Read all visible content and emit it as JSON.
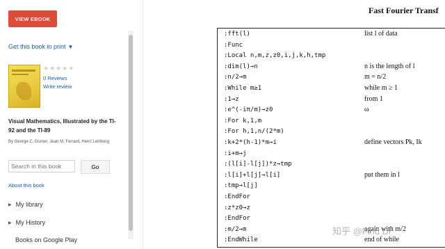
{
  "sidebar": {
    "view_ebook": "VIEW EBOOK",
    "get_print": "Get this book in print",
    "reviews_count": "0 Reviews",
    "write_review": "Write review",
    "book_title": "Visual Mathematics, Illustrated by the TI-92 and the TI-89",
    "authors": "By George C. Dorner, Jean M. Ferrard, Henri Lemberg",
    "search_placeholder": "Search in this book",
    "go_label": "Go",
    "about_link": "About this book",
    "nav": [
      "My library",
      "My History"
    ],
    "books_on_google_play": "Books on Google Play"
  },
  "page": {
    "title": "Fast Fourier Transf",
    "code_lines": [
      ":fft(l)",
      ":Func",
      ":Local n,m,z,z0,i,j,k,h,tmp",
      ":dim(l)→n",
      ":n/2→m",
      ":While m≥1",
      ":1→z",
      ":e^(-iπ/m)→z0",
      ":For k,1,m",
      ":For h,1,n/(2*m)",
      ":k+2*(h-1)*m→i",
      ":i+m→j",
      ":(l[i]-l[j])*z→tmp",
      ":l[i]+l[j]→l[i]",
      ":tmp→l[j]",
      ":EndFor",
      ":z*z0→z",
      ":EndFor",
      ":m/2→m",
      ":EndWhile"
    ],
    "comments": [
      {
        "line": 0,
        "text": "list l of data"
      },
      {
        "line": 3,
        "text": "n is the length of l"
      },
      {
        "line": 4,
        "text": "m = n/2"
      },
      {
        "line": 5,
        "text": "while m ≥ 1"
      },
      {
        "line": 6,
        "text": "from 1"
      },
      {
        "line": 7,
        "text": "ω"
      },
      {
        "line": 10,
        "text": "define vectors Pk, Ik"
      },
      {
        "line": 13,
        "text": "put them in l"
      },
      {
        "line": 18,
        "text": "again with m/2"
      },
      {
        "line": 19,
        "text": "end of while"
      }
    ],
    "watermark": "知乎 @Find Di"
  },
  "colors": {
    "accent_button": "#dd4b39",
    "link": "#1a5bb8"
  }
}
